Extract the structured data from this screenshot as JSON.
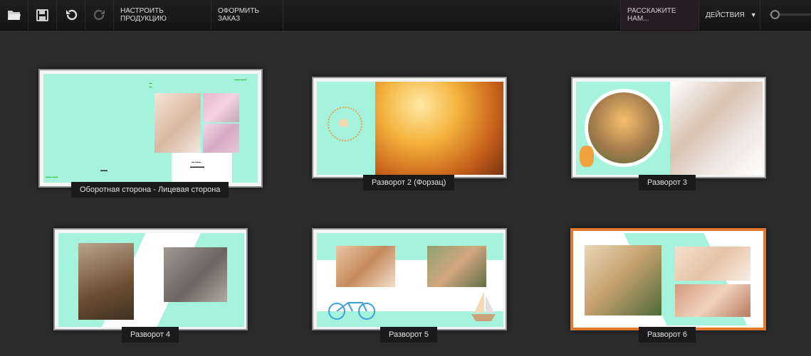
{
  "toolbar": {
    "icons": [
      "folder-open-icon",
      "save-icon",
      "undo-icon",
      "redo-icon"
    ],
    "configure_label": "НАСТРОИТЬ ПРОДУКЦИЮ",
    "order_label": "ОФОРМИТЬ ЗАКАЗ",
    "feedback_label": "РАССКАЖИТЕ НАМ...",
    "actions_label": "ДЕЙСТВИЯ",
    "actions_arrow": "▼"
  },
  "spreads": [
    {
      "label": "Оборотная сторона - Лицевая сторона"
    },
    {
      "label": "Разворот 2 (Форзац)"
    },
    {
      "label": "Разворот 3"
    },
    {
      "label": "Разворот 4"
    },
    {
      "label": "Разворот 5"
    },
    {
      "label": "Разворот 6"
    }
  ],
  "colors": {
    "mint": "#a6f3dd",
    "selected_border": "#e0792e",
    "toolbar_bg": "#1a1a1a",
    "workspace_bg": "#2b2b2b"
  }
}
